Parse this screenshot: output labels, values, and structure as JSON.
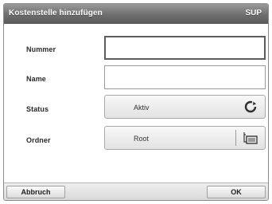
{
  "window": {
    "title": "Kostenstelle hinzufügen",
    "badge": "SUP"
  },
  "form": {
    "nummer": {
      "label": "Nummer",
      "value": ""
    },
    "name": {
      "label": "Name",
      "value": ""
    },
    "status": {
      "label": "Status",
      "value": "Aktiv",
      "icon": "cycle-icon"
    },
    "ordner": {
      "label": "Ordner",
      "value": "Root",
      "icon": "folder-tree-icon"
    }
  },
  "buttons": {
    "cancel": "Abbruch",
    "ok": "OK"
  }
}
